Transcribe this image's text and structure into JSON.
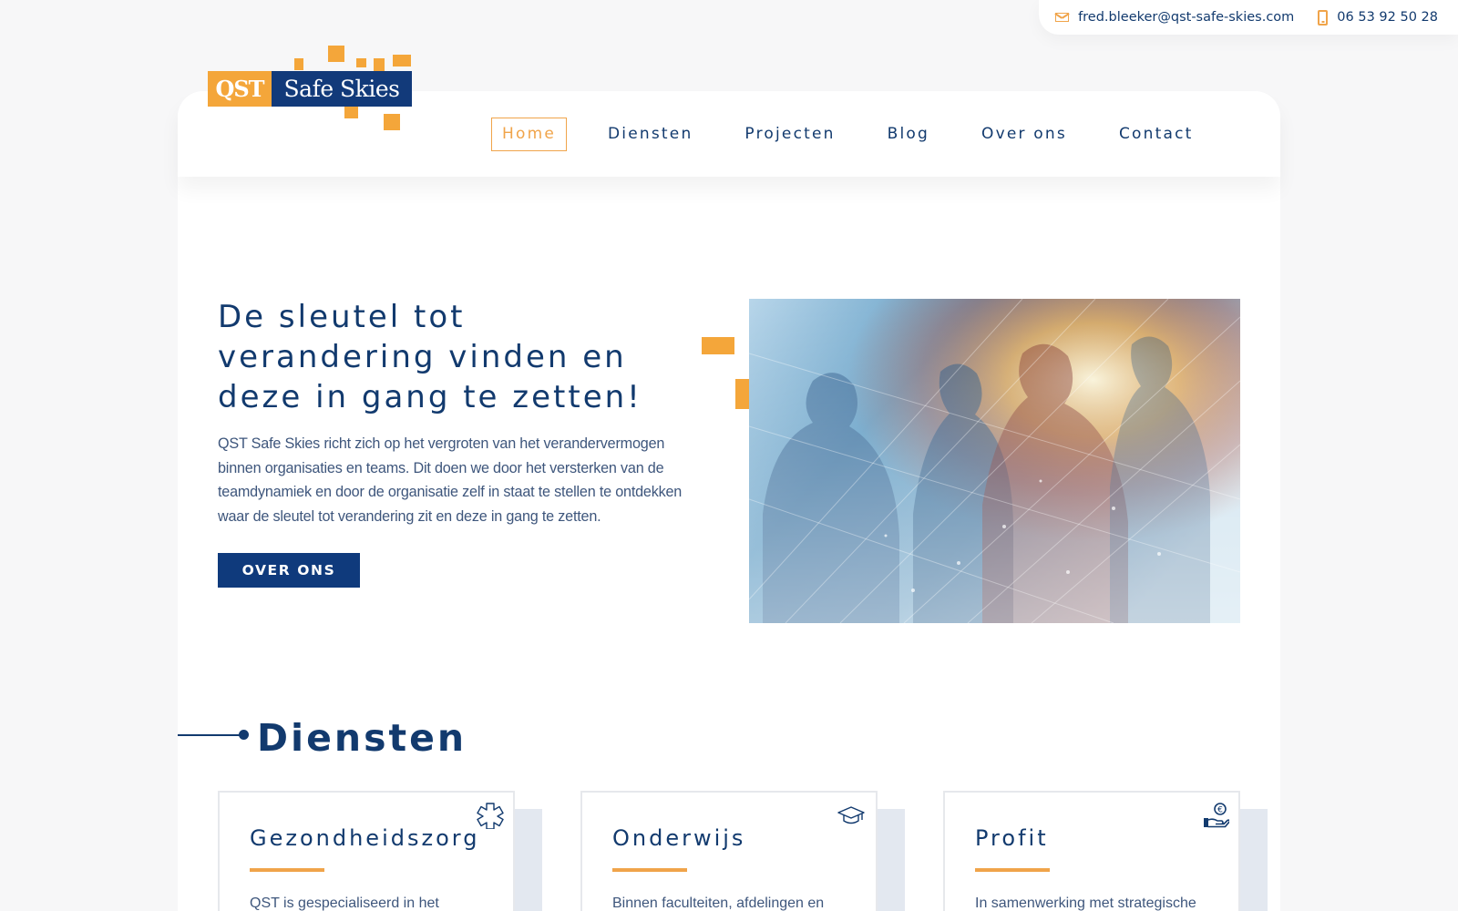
{
  "topbar": {
    "email": "fred.bleeker@qst-safe-skies.com",
    "phone": "06 53 92 50 28"
  },
  "logo": {
    "qst": "QST",
    "safe_skies": "Safe Skies"
  },
  "nav": {
    "items": [
      {
        "label": "Home",
        "active": true
      },
      {
        "label": "Diensten"
      },
      {
        "label": "Projecten"
      },
      {
        "label": "Blog"
      },
      {
        "label": "Over ons"
      },
      {
        "label": "Contact"
      }
    ]
  },
  "hero": {
    "title": "De sleutel tot verandering vinden en deze in gang te zetten!",
    "text": "QST Safe Skies richt zich op het vergroten van het verandervermogen binnen organisaties en teams. Dit doen we door het versterken van de teamdynamiek en door de organisatie zelf in staat te stellen te ontdekken waar de sleutel tot verandering zit en deze in gang te zetten.",
    "button": "OVER ONS",
    "image_icon": "business-handshake-image"
  },
  "services": {
    "title": "Diensten",
    "cards": [
      {
        "title": "Gezondheidszorg",
        "text": "QST is gespecialiseerd in het",
        "icon": "medical-cross-icon"
      },
      {
        "title": "Onderwijs",
        "text": "Binnen faculteiten, afdelingen en",
        "icon": "graduation-cap-icon"
      },
      {
        "title": "Profit",
        "text": "In samenwerking met strategische",
        "icon": "hand-euro-icon"
      }
    ]
  },
  "colors": {
    "navy": "#123a6e",
    "orange": "#f4a63a",
    "background": "#f7f7f8"
  }
}
